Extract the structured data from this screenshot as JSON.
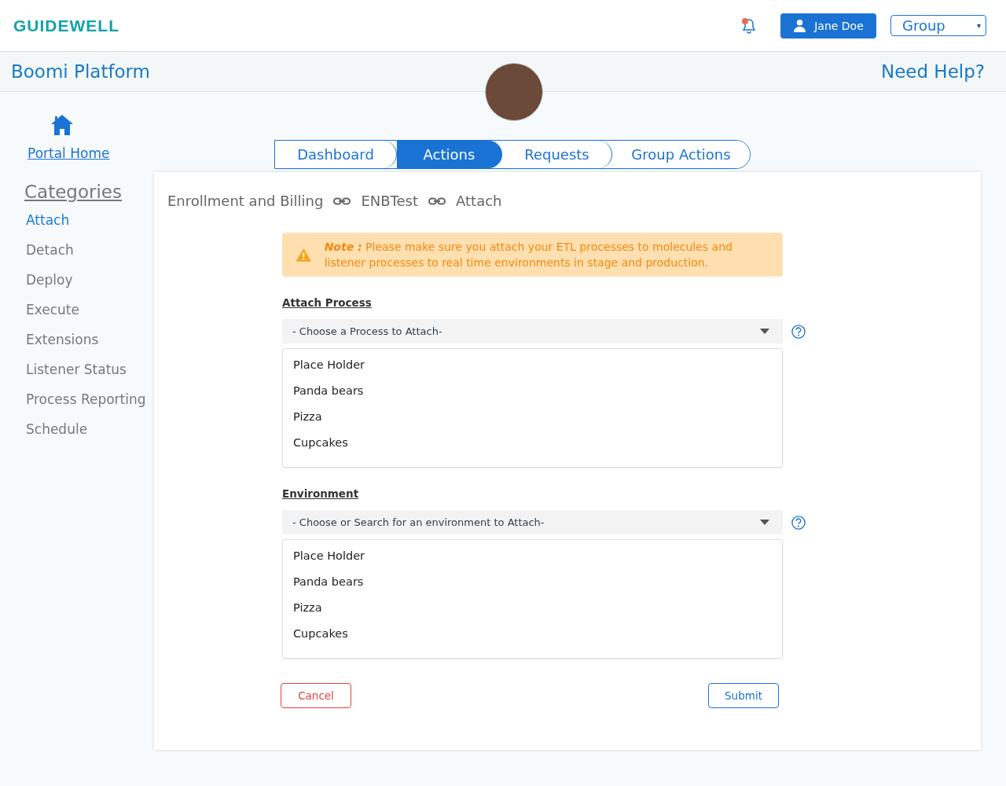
{
  "header": {
    "logo": "GUIDEWELL",
    "notifications": {
      "unread": true
    },
    "user_button": "Jane Doe",
    "group_select": {
      "value": "Group",
      "arrow": "▾"
    }
  },
  "title_bar": {
    "title": "Boomi Platform",
    "help_link": "Need Help?"
  },
  "sidebar": {
    "home_link": "Portal Home",
    "categories_heading": "Categories",
    "items": [
      {
        "label": "Attach",
        "selected": true
      },
      {
        "label": "Detach",
        "selected": false
      },
      {
        "label": "Deploy",
        "selected": false
      },
      {
        "label": "Execute",
        "selected": false
      },
      {
        "label": "Extensions",
        "selected": false
      },
      {
        "label": "Listener Status",
        "selected": false
      },
      {
        "label": "Process Reporting",
        "selected": false
      },
      {
        "label": "Schedule",
        "selected": false
      }
    ]
  },
  "tabs": [
    {
      "label": "Dashboard",
      "selected": false
    },
    {
      "label": "Actions",
      "selected": true
    },
    {
      "label": "Requests",
      "selected": false
    },
    {
      "label": "Group Actions",
      "selected": false
    }
  ],
  "breadcrumb": [
    "Enrollment and Billing",
    "ENBTest",
    "Attach"
  ],
  "note": {
    "label": "Note :",
    "text": "Please make sure you attach your ETL processes to molecules and listener processes to real time environments in stage and production."
  },
  "sections": [
    {
      "label": "Attach Process",
      "placeholder": "- Choose a Process to Attach-",
      "options": [
        "Place Holder",
        "Panda bears",
        "Pizza",
        "Cupcakes"
      ]
    },
    {
      "label": "Environment",
      "placeholder": "- Choose or Search for an environment to Attach-",
      "options": [
        "Place Holder",
        "Panda bears",
        "Pizza",
        "Cupcakes"
      ]
    }
  ],
  "buttons": {
    "cancel": "Cancel",
    "submit": "Submit"
  }
}
